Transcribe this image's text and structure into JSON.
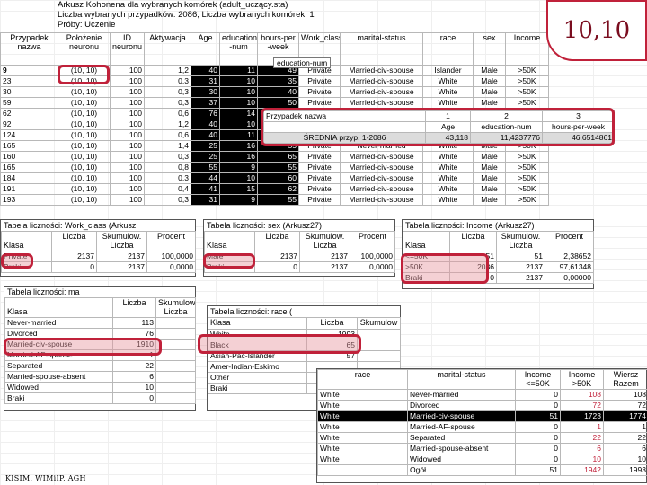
{
  "header": {
    "line1": "Arkusz Kohonena dla wybranych komórek (adult_uczący.sta)",
    "line2": "Liczba wybranych przypadków: 2086, Liczba wybranych komórek: 1",
    "line3": "Próby: Uczenie"
  },
  "badge": "10,10",
  "footer": "KISIM, WIMiIP, AGH",
  "main_table": {
    "headers": [
      "Przypadek nazwa",
      "Położenie neuronu",
      "ID neuronu",
      "Aktywacja",
      "Age",
      "education -num",
      "hours-per -week",
      "Work_class",
      "marital-status",
      "race",
      "sex",
      "Income"
    ],
    "tooltip": "education-num",
    "rows": [
      [
        "9",
        "(10, 10)",
        "100",
        "1,2",
        "40",
        "11",
        "49",
        "Private",
        "Married-civ-spouse",
        "Islander",
        "Male",
        ">50K"
      ],
      [
        "23",
        "(10, 10)",
        "100",
        "0,3",
        "31",
        "10",
        "35",
        "Private",
        "Married-civ-spouse",
        "White",
        "Male",
        ">50K"
      ],
      [
        "30",
        "(10, 10)",
        "100",
        "0,3",
        "30",
        "10",
        "40",
        "Private",
        "Married-civ-spouse",
        "White",
        "Male",
        ">50K"
      ],
      [
        "59",
        "(10, 10)",
        "100",
        "0,3",
        "37",
        "10",
        "50",
        "Private",
        "Married-civ-spouse",
        "White",
        "Male",
        ">50K"
      ],
      [
        "62",
        "(10, 10)",
        "100",
        "0,6",
        "76",
        "14",
        "",
        "",
        "",
        "",
        "Male",
        ">50K"
      ],
      [
        "92",
        "(10, 10)",
        "100",
        "1,2",
        "40",
        "10",
        "",
        "",
        "",
        "",
        "Male",
        ">50K"
      ],
      [
        "124",
        "(10, 10)",
        "100",
        "0,6",
        "40",
        "11",
        "",
        "",
        "",
        "",
        "Male",
        ">50K"
      ],
      [
        "165",
        "(10, 10)",
        "100",
        "1,4",
        "25",
        "16",
        "55",
        "Private",
        "Never-married",
        "White",
        "Male",
        ">50K"
      ],
      [
        "160",
        "(10, 10)",
        "100",
        "0,3",
        "25",
        "16",
        "65",
        "Private",
        "Married-civ-spouse",
        "White",
        "Male",
        ">50K"
      ],
      [
        "165",
        "(10, 10)",
        "100",
        "0,8",
        "55",
        "9",
        "55",
        "Private",
        "Married-civ-spouse",
        "White",
        "Male",
        ">50K"
      ],
      [
        "184",
        "(10, 10)",
        "100",
        "0,3",
        "44",
        "10",
        "60",
        "Private",
        "Married-civ-spouse",
        "White",
        "Male",
        ">50K"
      ],
      [
        "191",
        "(10, 10)",
        "100",
        "0,4",
        "41",
        "15",
        "62",
        "Private",
        "Married-civ-spouse",
        "White",
        "Male",
        ">50K"
      ],
      [
        "193",
        "(10, 10)",
        "100",
        "0,3",
        "31",
        "9",
        "55",
        "Private",
        "Married-civ-spouse",
        "White",
        "Male",
        ">50K"
      ]
    ]
  },
  "avg_panel": {
    "row1": [
      "Przypadek nazwa",
      "1",
      "2",
      "3"
    ],
    "row2": [
      "",
      "Age",
      "education-num",
      "hours-per-week"
    ],
    "row3": [
      "ŚREDNIA przyp. 1-2086",
      "43,118",
      "11,4237776",
      "46,6514861"
    ]
  },
  "freq_work": {
    "title": "Tabela liczności: Work_class (Arkusz",
    "headers": [
      "Klasa",
      "Liczba",
      "Skumulow. Liczba",
      "Procent"
    ],
    "rows": [
      [
        "Private",
        "2137",
        "2137",
        "100,0000"
      ],
      [
        "Braki",
        "0",
        "2137",
        "0,0000"
      ]
    ]
  },
  "freq_sex": {
    "title": "Tabela liczności: sex (Arkusz27)",
    "headers": [
      "Klasa",
      "Liczba",
      "Skumulow. Liczba",
      "Procent"
    ],
    "rows": [
      [
        "Male",
        "2137",
        "2137",
        "100,0000"
      ],
      [
        "Braki",
        "0",
        "2137",
        "0,0000"
      ]
    ]
  },
  "freq_income": {
    "title": "Tabela liczności: Income (Arkusz27)",
    "headers": [
      "Klasa",
      "Liczba",
      "Skumulow. Liczba",
      "Procent"
    ],
    "rows": [
      [
        "<=50K",
        "51",
        "51",
        "2,38652"
      ],
      [
        ">50K",
        "2086",
        "2137",
        "97,61348"
      ],
      [
        "Braki",
        "0",
        "2137",
        "0,00000"
      ]
    ]
  },
  "freq_marital": {
    "title": "Tabela liczności: ma",
    "headers": [
      "Klasa",
      "Liczba",
      "Skumulow. Liczba"
    ],
    "rows": [
      [
        "Never-married",
        "113",
        ""
      ],
      [
        "Divorced",
        "76",
        ""
      ],
      [
        "Married-civ-spouse",
        "1910",
        ""
      ],
      [
        "Married-AF-spouse",
        "1",
        ""
      ],
      [
        "Separated",
        "22",
        ""
      ],
      [
        "Married-spouse-absent",
        "6",
        ""
      ],
      [
        "Widowed",
        "10",
        ""
      ],
      [
        "Braki",
        "0",
        ""
      ]
    ]
  },
  "freq_race": {
    "title": "Tabela liczności: race (",
    "headers": [
      "Klasa",
      "Liczba",
      "Skumulow"
    ],
    "rows": [
      [
        "White",
        "1993",
        ""
      ],
      [
        "Black",
        "65",
        ""
      ],
      [
        "Asian-Pac-Islander",
        "57",
        ""
      ],
      [
        "Amer-Indian-Eskimo",
        "",
        ""
      ],
      [
        "Other",
        "",
        ""
      ],
      [
        "Braki",
        "",
        ""
      ]
    ]
  },
  "cross": {
    "headers": [
      "race",
      "marital-status",
      "Income <=50K",
      "Income >50K",
      "Wiersz Razem"
    ],
    "rows": [
      [
        "White",
        "Never-married",
        "0",
        "108",
        "108"
      ],
      [
        "White",
        "Divorced",
        "0",
        "72",
        "72"
      ],
      [
        "White",
        "Married-civ-spouse",
        "51",
        "1723",
        "1774"
      ],
      [
        "White",
        "Married-AF-spouse",
        "0",
        "1",
        "1"
      ],
      [
        "White",
        "Separated",
        "0",
        "22",
        "22"
      ],
      [
        "White",
        "Married-spouse-absent",
        "0",
        "6",
        "6"
      ],
      [
        "White",
        "Widowed",
        "0",
        "10",
        "10"
      ],
      [
        "",
        "Ogół",
        "51",
        "1942",
        "1993"
      ]
    ]
  },
  "colors": {
    "accent_red": "#c0213a",
    "highlight_pink": "#e696a0",
    "black_cells": "#000000"
  }
}
